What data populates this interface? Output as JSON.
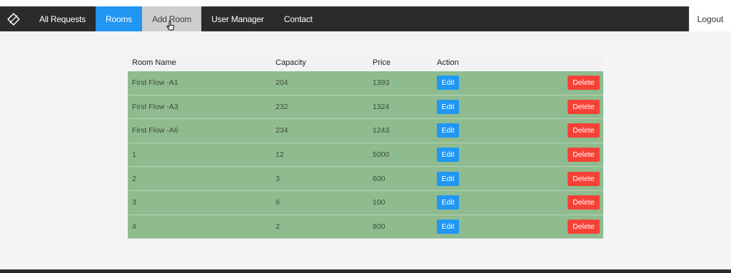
{
  "nav": {
    "items": [
      {
        "label": "All Requests"
      },
      {
        "label": "Rooms"
      },
      {
        "label": "Add Room"
      },
      {
        "label": "User Manager"
      },
      {
        "label": "Contact"
      }
    ],
    "active_item": "Rooms",
    "hovered_item": "Add Room",
    "logout_label": "Logout",
    "logo_icon": "diamond-logo-icon",
    "colors": {
      "navbar": "#2b2b2b",
      "active": "#2196f3",
      "hover": "#cfcfcf"
    }
  },
  "table": {
    "headers": {
      "room_name": "Room Name",
      "capacity": "Capacity",
      "price": "Price",
      "action": "Action"
    },
    "edit_label": "Edit",
    "delete_label": "Delete",
    "row_color": "#8fbc8f",
    "rows": [
      {
        "room_name": "First Flow -A1",
        "capacity": "204",
        "price": "1393"
      },
      {
        "room_name": "First Flow -A3",
        "capacity": "232",
        "price": "1324"
      },
      {
        "room_name": "First Flow -A6",
        "capacity": "234",
        "price": "1243"
      },
      {
        "room_name": "1",
        "capacity": "12",
        "price": "5000"
      },
      {
        "room_name": "2",
        "capacity": "3",
        "price": "600"
      },
      {
        "room_name": "3",
        "capacity": "6",
        "price": "100"
      },
      {
        "room_name": "4",
        "capacity": "2",
        "price": "800"
      }
    ]
  }
}
